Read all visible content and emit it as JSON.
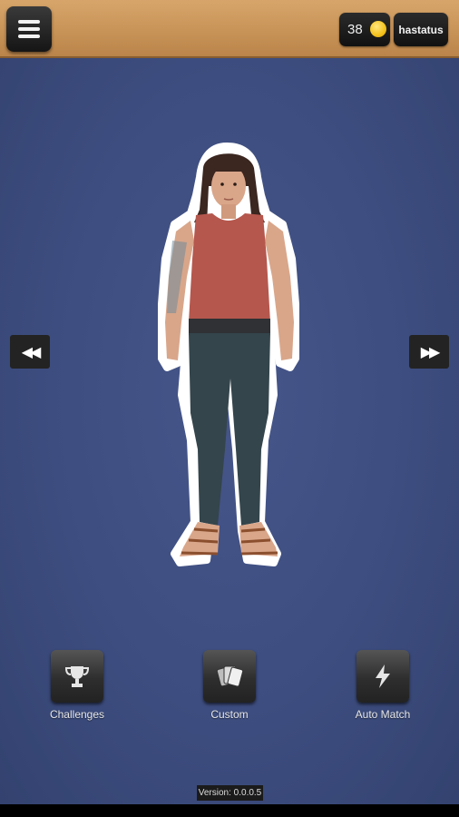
{
  "header": {
    "coins": "38",
    "username": "hastatus"
  },
  "actions": [
    {
      "label": "Challenges",
      "icon": "trophy-icon"
    },
    {
      "label": "Custom",
      "icon": "cards-icon"
    },
    {
      "label": "Auto Match",
      "icon": "lightning-icon"
    }
  ],
  "footer": {
    "version": "Version: 0.0.0.5"
  },
  "colors": {
    "background": "#3d4d7f",
    "wood": "#c89357",
    "coin": "#f3c21b"
  }
}
